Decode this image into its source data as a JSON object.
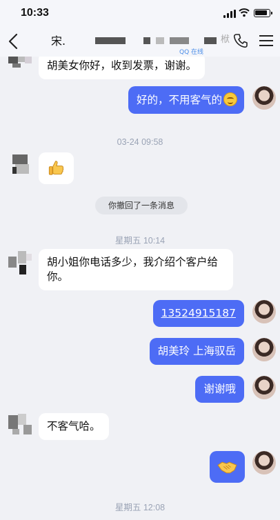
{
  "status": {
    "time": "10:33"
  },
  "header": {
    "name": "宋.",
    "subtitle": "QQ 在线",
    "name_tail": "栿"
  },
  "messages": [
    {
      "dir": "in",
      "text": "胡美女你好，收到发票，谢谢。"
    },
    {
      "dir": "out",
      "text": "好的，不用客气的"
    },
    {
      "ts": "03-24 09:58"
    },
    {
      "dir": "in",
      "emoji": "thumbs-up"
    },
    {
      "system": "你撤回了一条消息"
    },
    {
      "ts": "星期五 10:14"
    },
    {
      "dir": "in",
      "text": "胡小姐你电话多少，我介绍个客户给你。"
    },
    {
      "dir": "out",
      "text": "13524915187"
    },
    {
      "dir": "out",
      "text": "胡美玲 上海驭岳"
    },
    {
      "dir": "out",
      "text": "谢谢哦"
    },
    {
      "dir": "in",
      "text": "不客气哈。"
    },
    {
      "dir": "out",
      "emoji": "handshake"
    },
    {
      "ts": "星期五 12:08"
    }
  ],
  "colors": {
    "accent": "#4d6cf5",
    "background": "#f0f1f5"
  }
}
